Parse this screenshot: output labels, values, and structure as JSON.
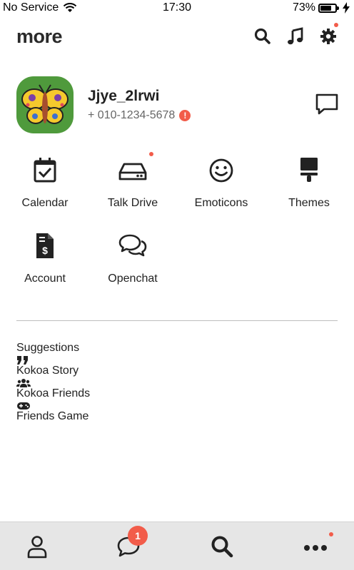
{
  "status_bar": {
    "carrier": "No Service",
    "time": "17:30",
    "battery_percent": "73%",
    "battery_level": 0.73
  },
  "header": {
    "title": "more"
  },
  "profile": {
    "name": "Jjye_2lrwi",
    "phone": "+ 010-1234-5678"
  },
  "grid": {
    "items": [
      {
        "label": "Calendar",
        "icon": "calendar-check-icon"
      },
      {
        "label": "Talk Drive",
        "icon": "hard-drive-icon"
      },
      {
        "label": "Emoticons",
        "icon": "smile-icon"
      },
      {
        "label": "Themes",
        "icon": "paintbrush-icon"
      },
      {
        "label": "Account",
        "icon": "invoice-dollar-icon"
      },
      {
        "label": "Openchat",
        "icon": "comments-icon"
      }
    ]
  },
  "suggestions": {
    "title": "Suggestions",
    "items": [
      {
        "label": "Kokoa Story",
        "icon": "quote-icon"
      },
      {
        "label": "Kokoa Friends",
        "icon": "users-icon"
      },
      {
        "label": "Friends Game",
        "icon": "gamepad-icon"
      }
    ]
  },
  "tabbar": {
    "chats_badge": "1"
  },
  "colors": {
    "accent": "#f25c4a",
    "tabbar_bg": "#e6e6e6",
    "icon": "#222222",
    "avatar_bg": "#4f9a3c"
  }
}
